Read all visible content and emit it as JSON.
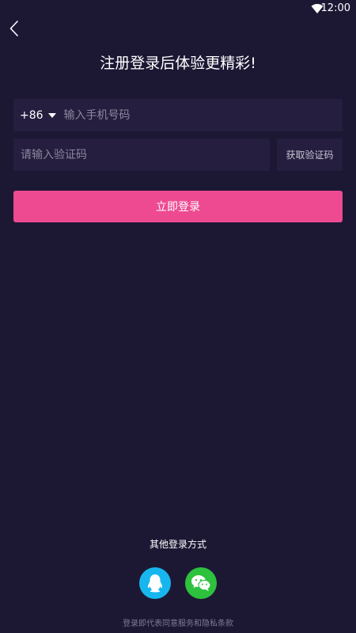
{
  "status_bar": {
    "time": "12:00"
  },
  "header": {
    "title": "注册登录后体验更精彩!"
  },
  "phone": {
    "country_code": "+86",
    "placeholder": "输入手机号码",
    "value": ""
  },
  "verification": {
    "placeholder": "请输入验证码",
    "value": "",
    "get_code_label": "获取验证码"
  },
  "login_button": {
    "label": "立即登录"
  },
  "other_login": {
    "title": "其他登录方式",
    "methods": [
      {
        "icon": "qq-icon",
        "color": "#18b6ee"
      },
      {
        "icon": "wechat-icon",
        "color": "#2dc13e"
      }
    ]
  },
  "terms": {
    "text": "登录即代表同意服务和隐私条款"
  },
  "colors": {
    "background": "#1c1834",
    "field": "#251e3f",
    "accent": "#ed4a92"
  }
}
